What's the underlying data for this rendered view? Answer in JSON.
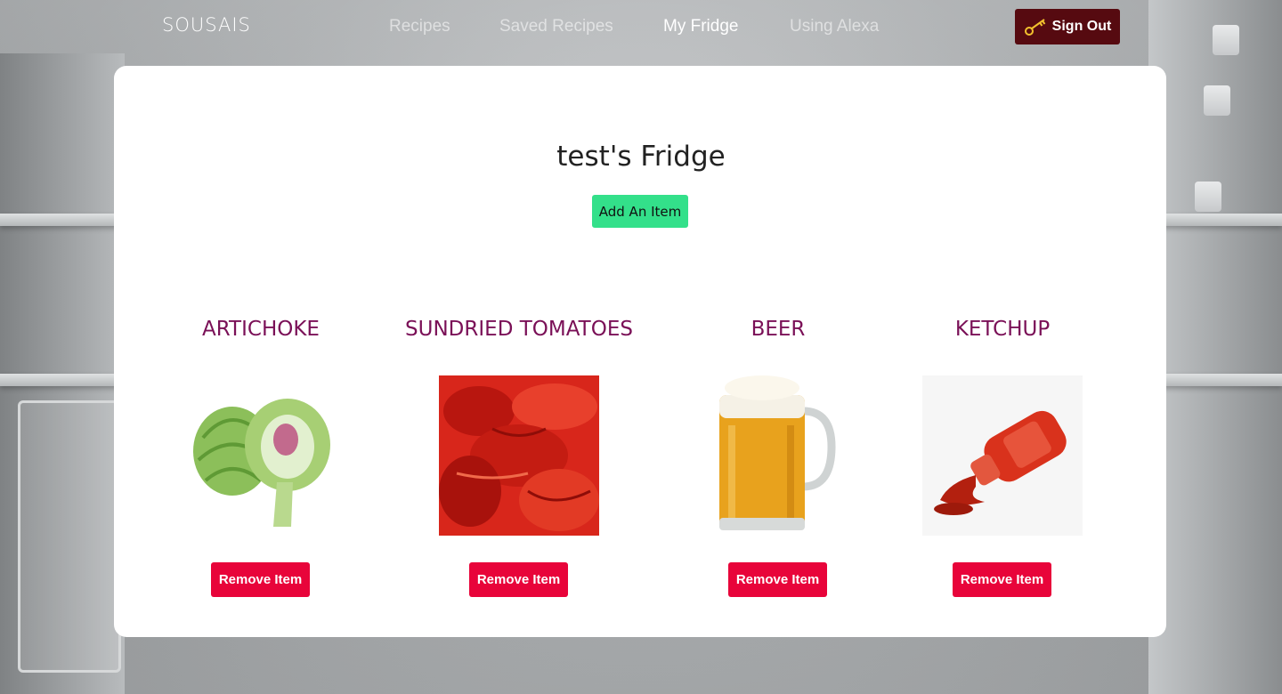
{
  "nav": {
    "brand": "SOUSAIS",
    "links": [
      {
        "label": "Recipes",
        "active": false
      },
      {
        "label": "Saved Recipes",
        "active": false
      },
      {
        "label": "My Fridge",
        "active": true
      },
      {
        "label": "Using Alexa",
        "active": false
      }
    ],
    "signout_label": "Sign Out",
    "signout_icon": "key-icon"
  },
  "fridge": {
    "title": "test's Fridge",
    "add_label": "Add An Item",
    "items": [
      {
        "name": "ARTICHOKE",
        "image": "artichoke",
        "remove_label": "Remove Item"
      },
      {
        "name": "SUNDRIED TOMATOES",
        "image": "sundried-tomatoes",
        "remove_label": "Remove Item"
      },
      {
        "name": "BEER",
        "image": "beer-mug",
        "remove_label": "Remove Item"
      },
      {
        "name": "KETCHUP",
        "image": "ketchup-bottle",
        "remove_label": "Remove Item"
      }
    ]
  },
  "colors": {
    "item_name": "#7a1057",
    "add_button": "#33e08a",
    "remove_button": "#e8043a",
    "signout_button": "#560a10"
  }
}
